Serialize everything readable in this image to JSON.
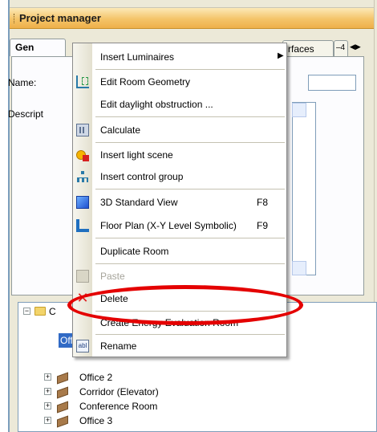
{
  "window": {
    "title": "Project manager"
  },
  "tabs": [
    {
      "label": "Gen"
    },
    {
      "label": "rfaces"
    },
    {
      "label": "–4"
    }
  ],
  "form": {
    "name_label": "Name:",
    "description_label": "Descript"
  },
  "context_menu": {
    "items": [
      {
        "label": "Insert Luminaires",
        "icon": "none",
        "submenu": true
      },
      {
        "label": "Edit Room Geometry",
        "icon": "room-geometry-icon"
      },
      {
        "label": "Edit daylight obstruction ...",
        "icon": "none"
      },
      {
        "label": "Calculate",
        "icon": "calculator-icon"
      },
      {
        "label": "Insert light scene",
        "icon": "light-scene-icon"
      },
      {
        "label": "Insert control group",
        "icon": "control-group-icon"
      },
      {
        "label": "3D Standard View",
        "icon": "3d-view-icon",
        "shortcut": "F8"
      },
      {
        "label": "Floor Plan (X-Y Level Symbolic)",
        "icon": "floor-plan-icon",
        "shortcut": "F9"
      },
      {
        "label": "Duplicate Room",
        "icon": "none"
      },
      {
        "label": "Paste",
        "icon": "paste-icon",
        "disabled": true
      },
      {
        "label": "Delete",
        "icon": "delete-icon"
      },
      {
        "label": "Create Energy Evaluation Room",
        "icon": "none"
      },
      {
        "label": "Rename",
        "icon": "rename-icon"
      }
    ]
  },
  "tree": {
    "root_label": "C",
    "items": [
      {
        "label": "Office 1",
        "selected": true
      },
      {
        "label": "Office 2"
      },
      {
        "label": "Corridor (Elevator)"
      },
      {
        "label": "Conference Room"
      },
      {
        "label": "Office 3"
      }
    ]
  },
  "annotation": {
    "highlight_color": "#e40000",
    "highlighted_item": "Create Energy Evaluation Room"
  },
  "colors": {
    "title_bar": "#f4c469",
    "selection": "#316ac5",
    "panel": "#ece9d8"
  }
}
